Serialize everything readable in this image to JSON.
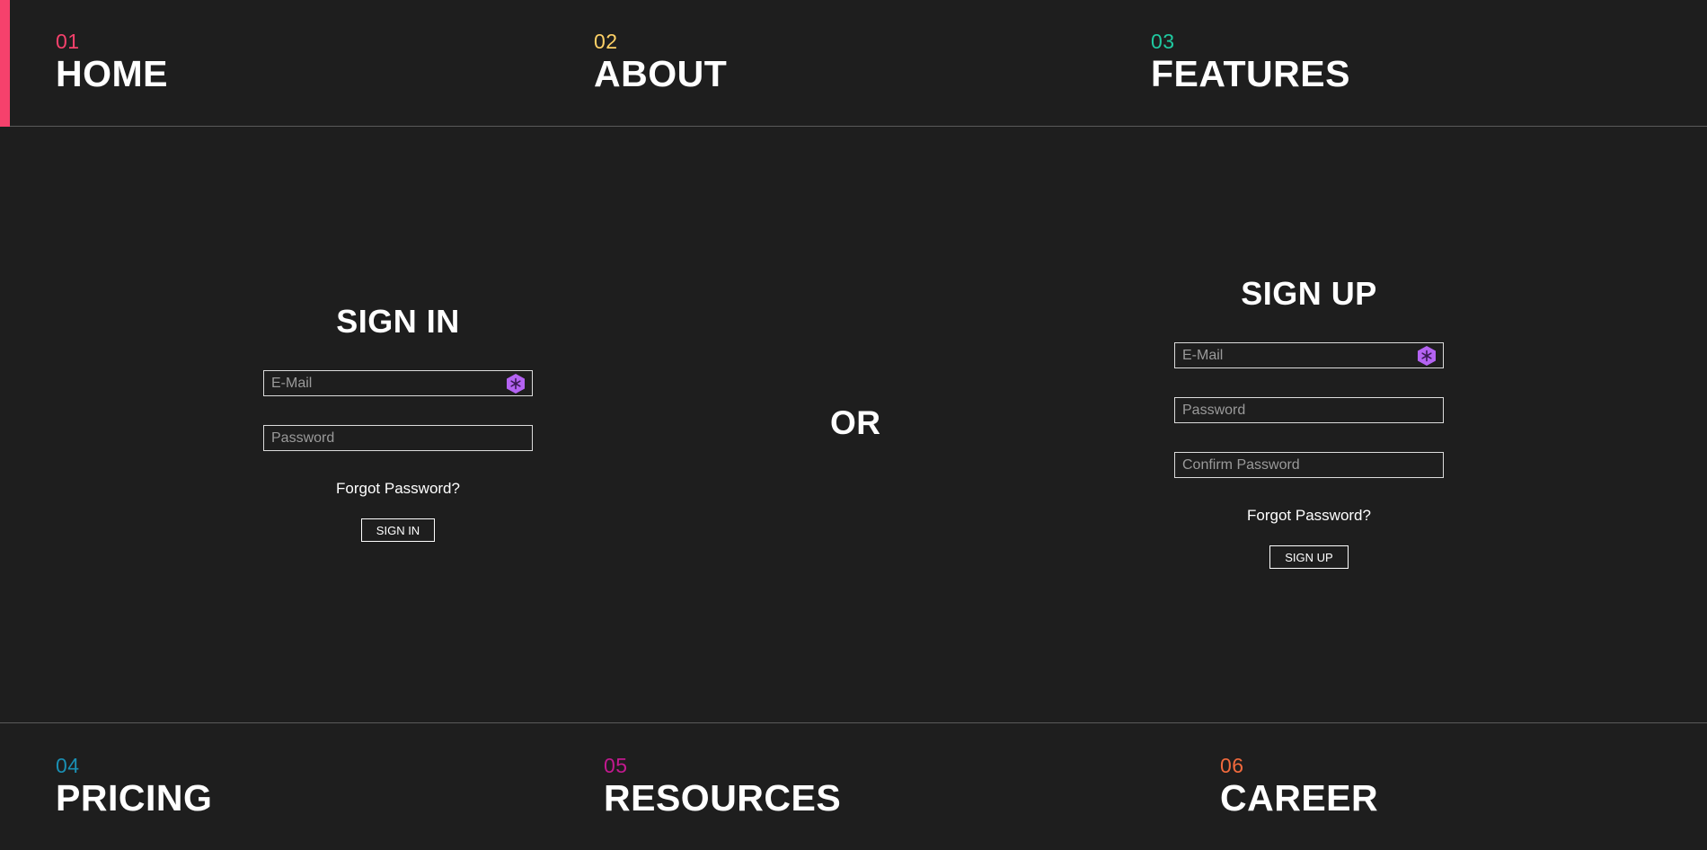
{
  "top_nav": {
    "items": [
      {
        "num": "01",
        "label": "HOME",
        "color": "#f6416c"
      },
      {
        "num": "02",
        "label": "ABOUT",
        "color": "#ffd166"
      },
      {
        "num": "03",
        "label": "FEATURES",
        "color": "#1fc9a0"
      }
    ]
  },
  "bottom_nav": {
    "items": [
      {
        "num": "04",
        "label": "PRICING",
        "color": "#1a8fb3"
      },
      {
        "num": "05",
        "label": "RESOURCES",
        "color": "#c2198f"
      },
      {
        "num": "06",
        "label": "CAREER",
        "color": "#f26a3d"
      }
    ]
  },
  "sign_in": {
    "title": "SIGN IN",
    "email_placeholder": "E-Mail",
    "password_placeholder": "Password",
    "forgot": "Forgot Password?",
    "button": "SIGN IN"
  },
  "divider": {
    "text": "OR"
  },
  "sign_up": {
    "title": "SIGN UP",
    "email_placeholder": "E-Mail",
    "password_placeholder": "Password",
    "confirm_placeholder": "Confirm Password",
    "forgot": "Forgot Password?",
    "button": "SIGN UP"
  },
  "colors": {
    "background": "#1e1e1e",
    "accent": "#f6416c",
    "autofill_icon": "#b463f2"
  },
  "icons": {
    "autofill": "hexagon-asterisk-icon"
  }
}
